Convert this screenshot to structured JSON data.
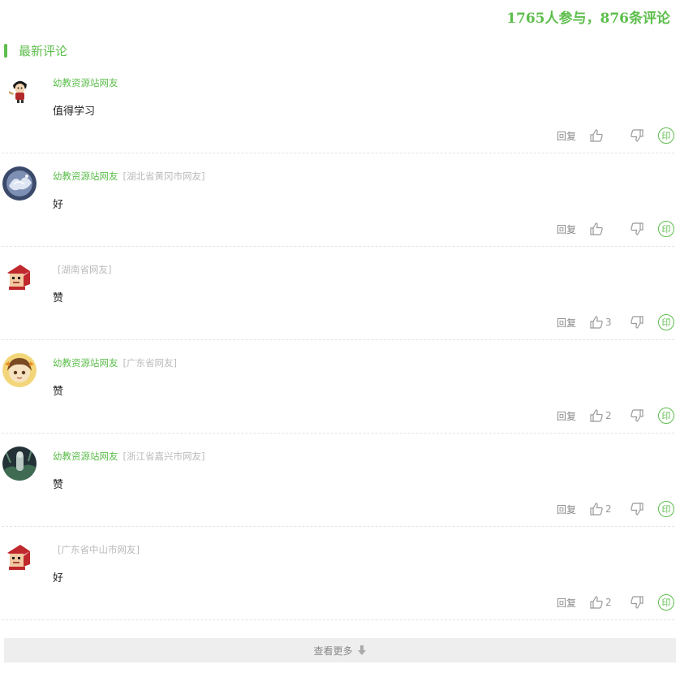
{
  "stats": "1765人参与，876条评论",
  "section_title": "最新评论",
  "load_more": "查看更多",
  "actions": {
    "reply": "回复",
    "stamp": "印"
  },
  "comments": [
    {
      "user": "幼教资源站网友",
      "location": "",
      "content": "值得学习",
      "likes": ""
    },
    {
      "user": "幼教资源站网友",
      "location": "[湖北省黄冈市网友]",
      "content": "好",
      "likes": ""
    },
    {
      "user": "",
      "location": "[湖南省网友]",
      "content": "赞",
      "likes": "3"
    },
    {
      "user": "幼教资源站网友",
      "location": "[广东省网友]",
      "content": "赞",
      "likes": "2"
    },
    {
      "user": "幼教资源站网友",
      "location": "[浙江省嘉兴市网友]",
      "content": "赞",
      "likes": "2"
    },
    {
      "user": "",
      "location": "[广东省中山市网友]",
      "content": "好",
      "likes": "2"
    }
  ],
  "colors": {
    "accent": "#5cbe4b",
    "muted": "#bbbbbb",
    "divider": "#e4e4e4",
    "more_bg": "#eeeeee"
  },
  "icons": [
    "thumbs-up-icon",
    "thumbs-down-icon",
    "stamp-icon",
    "arrow-down-icon"
  ]
}
